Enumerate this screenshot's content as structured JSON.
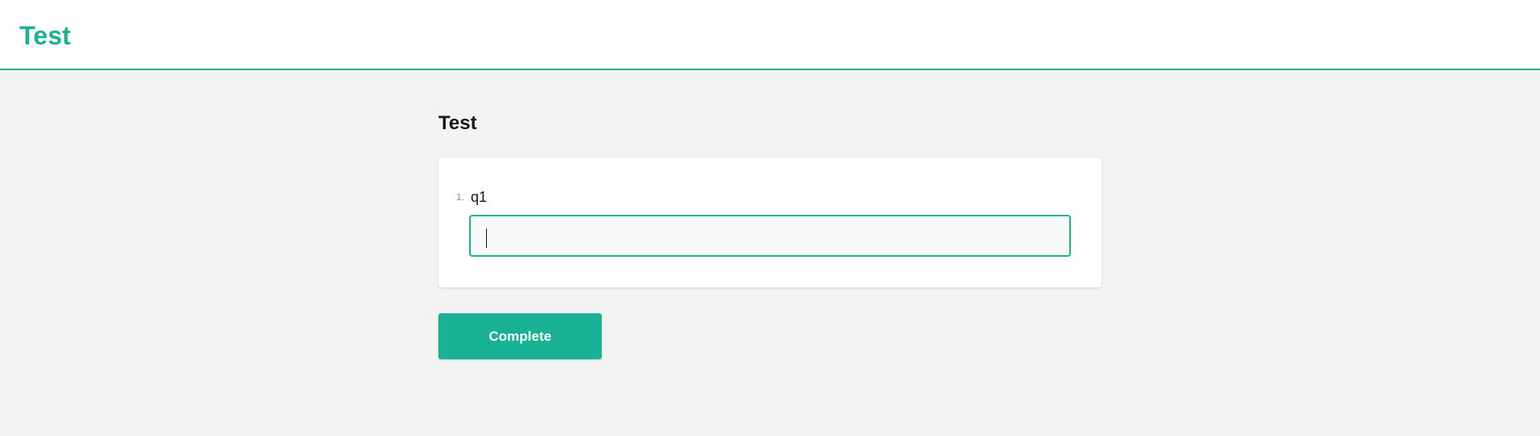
{
  "header": {
    "brand_title": "Test"
  },
  "survey": {
    "title": "Test",
    "questions": [
      {
        "number": "1.",
        "title": "q1",
        "value": "",
        "placeholder": ""
      }
    ],
    "complete_label": "Complete"
  },
  "colors": {
    "accent": "#19b394",
    "page_background": "#f3f3f3",
    "card_background": "#ffffff",
    "input_background": "#f9f9f9",
    "text": "#161616",
    "muted_text": "#909090"
  }
}
